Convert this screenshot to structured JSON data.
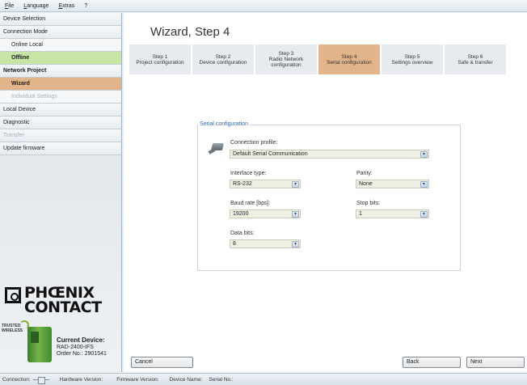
{
  "menu": {
    "items": [
      "File",
      "Language",
      "Extras",
      "?"
    ]
  },
  "sidebar": {
    "device_selection": "Device Selection",
    "connection_mode": "Connection Mode",
    "online_local": "Online Local",
    "offline": "Offline",
    "network_project": "Network Project",
    "wizard": "Wizard",
    "individual_settings": "Individual Settings",
    "local_device": "Local Device",
    "diagnostic": "Diagnostic",
    "transfer": "Transfer",
    "update_firmware": "Update firmware"
  },
  "brand": {
    "logo_text": "PHOENIX CONTACT",
    "badge": "TRUSTED WIRELESS"
  },
  "current_device": {
    "title": "Current Device:",
    "model": "RAD-2400-IFS",
    "order": "Order No.: 2901541"
  },
  "wizard": {
    "title": "Wizard, Step 4",
    "steps": [
      {
        "num": "Step 1",
        "label": "Project configuration"
      },
      {
        "num": "Step 2",
        "label": "Device configuration"
      },
      {
        "num": "Step 3",
        "label": "Radio Network configuration"
      },
      {
        "num": "Step 4",
        "label": "Serial configuration"
      },
      {
        "num": "Step 5",
        "label": "Settings overview"
      },
      {
        "num": "Step 6",
        "label": "Safe & transfer"
      }
    ],
    "active_step": 4
  },
  "serial": {
    "group_title": "Serial configuration",
    "connection_profile_label": "Connection profile:",
    "connection_profile_value": "Default Serial Communication",
    "interface_type_label": "Interface type:",
    "interface_type_value": "RS-232",
    "parity_label": "Parity:",
    "parity_value": "None",
    "baud_rate_label": "Baud rate [bps]:",
    "baud_rate_value": "19200",
    "stop_bits_label": "Stop bits:",
    "stop_bits_value": "1",
    "data_bits_label": "Data bits:",
    "data_bits_value": "8"
  },
  "buttons": {
    "cancel": "Cancel",
    "back": "Back",
    "next": "Next"
  },
  "status": {
    "connection": "Connection:",
    "hardware_version": "Hardware Version:",
    "firmware_version": "Firmware Version:",
    "device_name": "Device Name:",
    "serial_no": "Serial No.:"
  },
  "colors": {
    "active_step": "#e1b48a",
    "offline_green": "#c7e6a6",
    "legend_blue": "#3a68a8"
  }
}
